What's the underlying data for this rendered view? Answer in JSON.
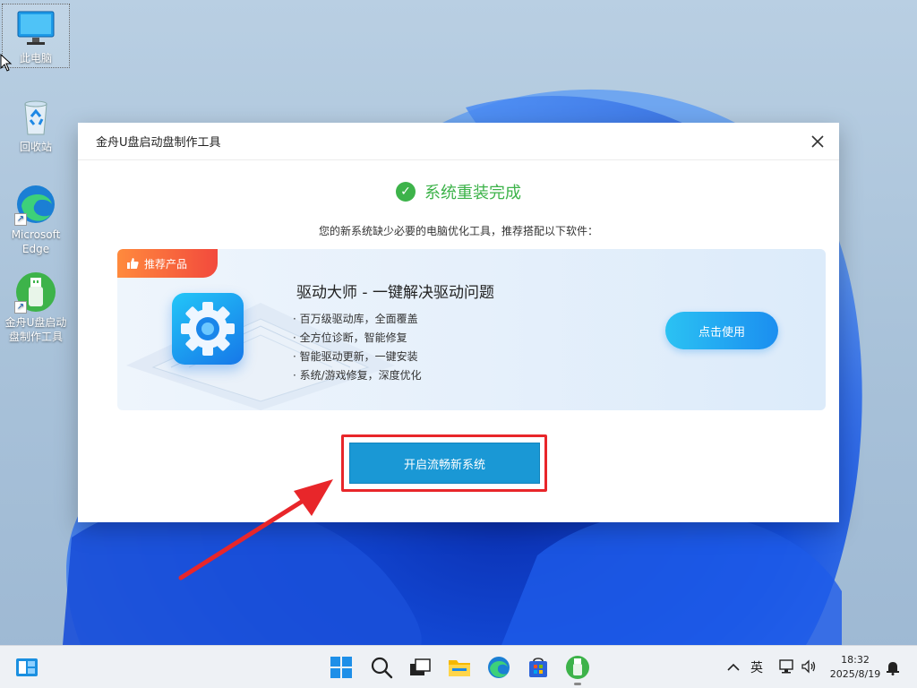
{
  "desktop": {
    "icons": [
      {
        "label": "此电脑",
        "icon": "monitor-icon"
      },
      {
        "label": "回收站",
        "icon": "recycle-bin-icon"
      },
      {
        "label": "Microsoft Edge",
        "icon": "edge-icon"
      },
      {
        "label": "金舟U盘启动盘制作工具",
        "icon": "usb-tool-icon"
      }
    ]
  },
  "dialog": {
    "title": "金舟U盘启动盘制作工具",
    "status": "系统重装完成",
    "subtitle": "您的新系统缺少必要的电脑优化工具，推荐搭配以下软件：",
    "promo": {
      "badge": "推荐产品",
      "title": "驱动大师 - 一键解决驱动问题",
      "features": [
        "· 百万级驱动库，全面覆盖",
        "· 全方位诊断，智能修复",
        "· 智能驱动更新，一键安装",
        "· 系统/游戏修复，深度优化"
      ],
      "button": "点击使用"
    },
    "primary_button": "开启流畅新系统"
  },
  "taskbar": {
    "apps": [
      "widgets-icon",
      "start-icon",
      "search-icon",
      "task-view-icon",
      "file-explorer-icon",
      "edge-icon",
      "store-icon",
      "usb-tool-icon"
    ],
    "ime": "英",
    "time": "18:32",
    "date": "2025/8/19"
  },
  "colors": {
    "success": "#3db34a",
    "primary": "#1a98d5",
    "highlight": "#e8262a",
    "badge": "#f24a3d"
  }
}
